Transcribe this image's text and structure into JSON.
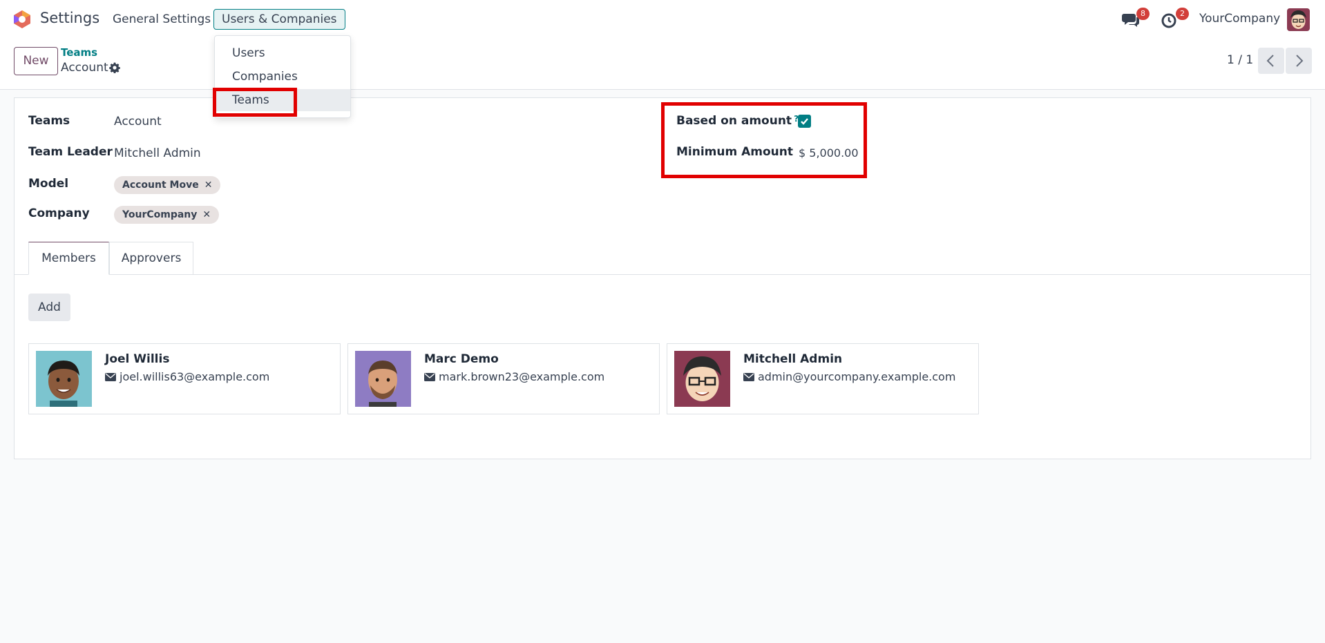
{
  "navbar": {
    "app_name": "Settings",
    "menus": [
      "General Settings",
      "Users & Companies"
    ],
    "messages_count": "8",
    "activities_count": "2",
    "company": "YourCompany"
  },
  "dropdown": {
    "items": [
      "Users",
      "Companies",
      "Teams"
    ]
  },
  "control": {
    "new_label": "New",
    "breadcrumb_parent": "Teams",
    "breadcrumb_current": "Account",
    "pager": "1 / 1"
  },
  "form": {
    "teams_label": "Teams",
    "teams_value": "Account",
    "leader_label": "Team Leader",
    "leader_value": "Mitchell Admin",
    "model_label": "Model",
    "model_tag": "Account Move",
    "company_label": "Company",
    "company_tag": "YourCompany",
    "based_label": "Based on amount",
    "help_mark": "?",
    "based_checked": true,
    "min_label": "Minimum Amount",
    "min_value": "$ 5,000.00"
  },
  "tabs": [
    "Members",
    "Approvers"
  ],
  "add_label": "Add",
  "tag_remove": "✕",
  "members": [
    {
      "name": "Joel Willis",
      "email": "joel.willis63@example.com"
    },
    {
      "name": "Marc Demo",
      "email": "mark.brown23@example.com"
    },
    {
      "name": "Mitchell Admin",
      "email": "admin@yourcompany.example.com"
    }
  ],
  "colors": {
    "brand_purple": "#714b67",
    "accent_teal": "#017e84",
    "highlight_red": "#e10000",
    "badge_red": "#d23f3a"
  }
}
